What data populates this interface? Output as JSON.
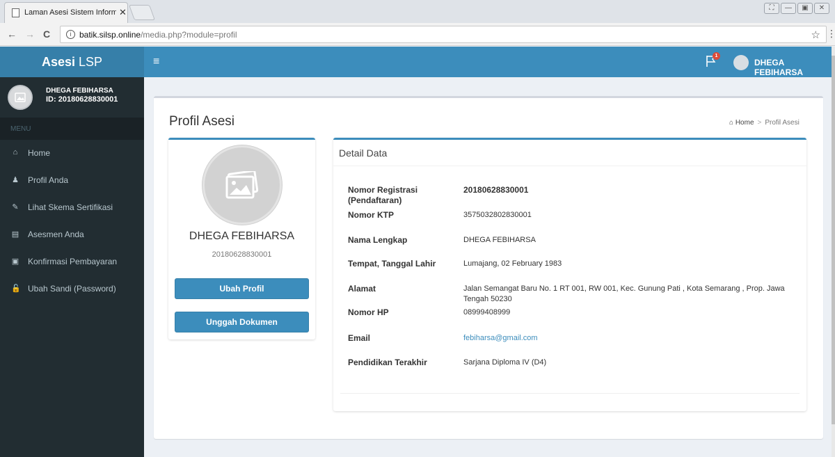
{
  "browser": {
    "tab_title": "Laman Asesi Sistem Inform",
    "tab_close": "✕",
    "url_host": "batik.silsp.online",
    "url_path": "/media.php?module=profil",
    "info_glyph": "i",
    "star_glyph": "☆",
    "menu_glyph": "⋮",
    "back_glyph": "←",
    "forward_glyph": "→",
    "reload_glyph": "C",
    "window_buttons": [
      "⛶",
      "—",
      "▣",
      "✕"
    ]
  },
  "header": {
    "logo_bold": "Asesi",
    "logo_rest": " LSP",
    "burger_glyph": "≡",
    "notification_count": "1",
    "user_name": "DHEGA FEBIHARSA",
    "color_primary": "#3c8dbc",
    "color_logo": "#367fa9"
  },
  "sidebar": {
    "user_name": "DHEGA FEBIHARSA",
    "user_id": "ID: 20180628830001",
    "menu_header": "MENU",
    "items": [
      {
        "label": "Home",
        "glyph": "⌂"
      },
      {
        "label": "Profil Anda",
        "glyph": "♟"
      },
      {
        "label": "Lihat Skema Sertifikasi",
        "glyph": "✎"
      },
      {
        "label": "Asesmen Anda",
        "glyph": "▤"
      },
      {
        "label": "Konfirmasi Pembayaran",
        "glyph": "▣"
      },
      {
        "label": "Ubah Sandi (Password)",
        "glyph": "🔓"
      }
    ],
    "color_bg": "#222d32"
  },
  "page": {
    "title": "Profil Asesi",
    "breadcrumb_home": "Home",
    "breadcrumb_sep": ">",
    "breadcrumb_current": "Profil Asesi",
    "home_glyph": "⌂"
  },
  "profile": {
    "name": "DHEGA FEBIHARSA",
    "id": "20180628830001",
    "btn_edit": "Ubah Profil",
    "btn_upload": "Unggah Dokumen"
  },
  "detail": {
    "title": "Detail Data",
    "rows": [
      {
        "label": "Nomor Registrasi (Pendaftaran)",
        "value": "20180628830001"
      },
      {
        "label": "Nomor KTP",
        "value": "3575032802830001"
      },
      {
        "label": "Nama Lengkap",
        "value": "DHEGA FEBIHARSA"
      },
      {
        "label": "Tempat, Tanggal Lahir",
        "value": "Lumajang, 02 February 1983"
      },
      {
        "label": "Alamat",
        "value": "Jalan Semangat Baru No. 1 RT 001, RW 001, Kec. Gunung Pati , Kota Semarang , Prop. Jawa Tengah 50230"
      },
      {
        "label": "Nomor HP",
        "value": "08999408999"
      },
      {
        "label": "Email",
        "value": "febiharsa@gmail.com"
      },
      {
        "label": "Pendidikan Terakhir",
        "value": "Sarjana Diploma IV (D4)"
      }
    ]
  }
}
